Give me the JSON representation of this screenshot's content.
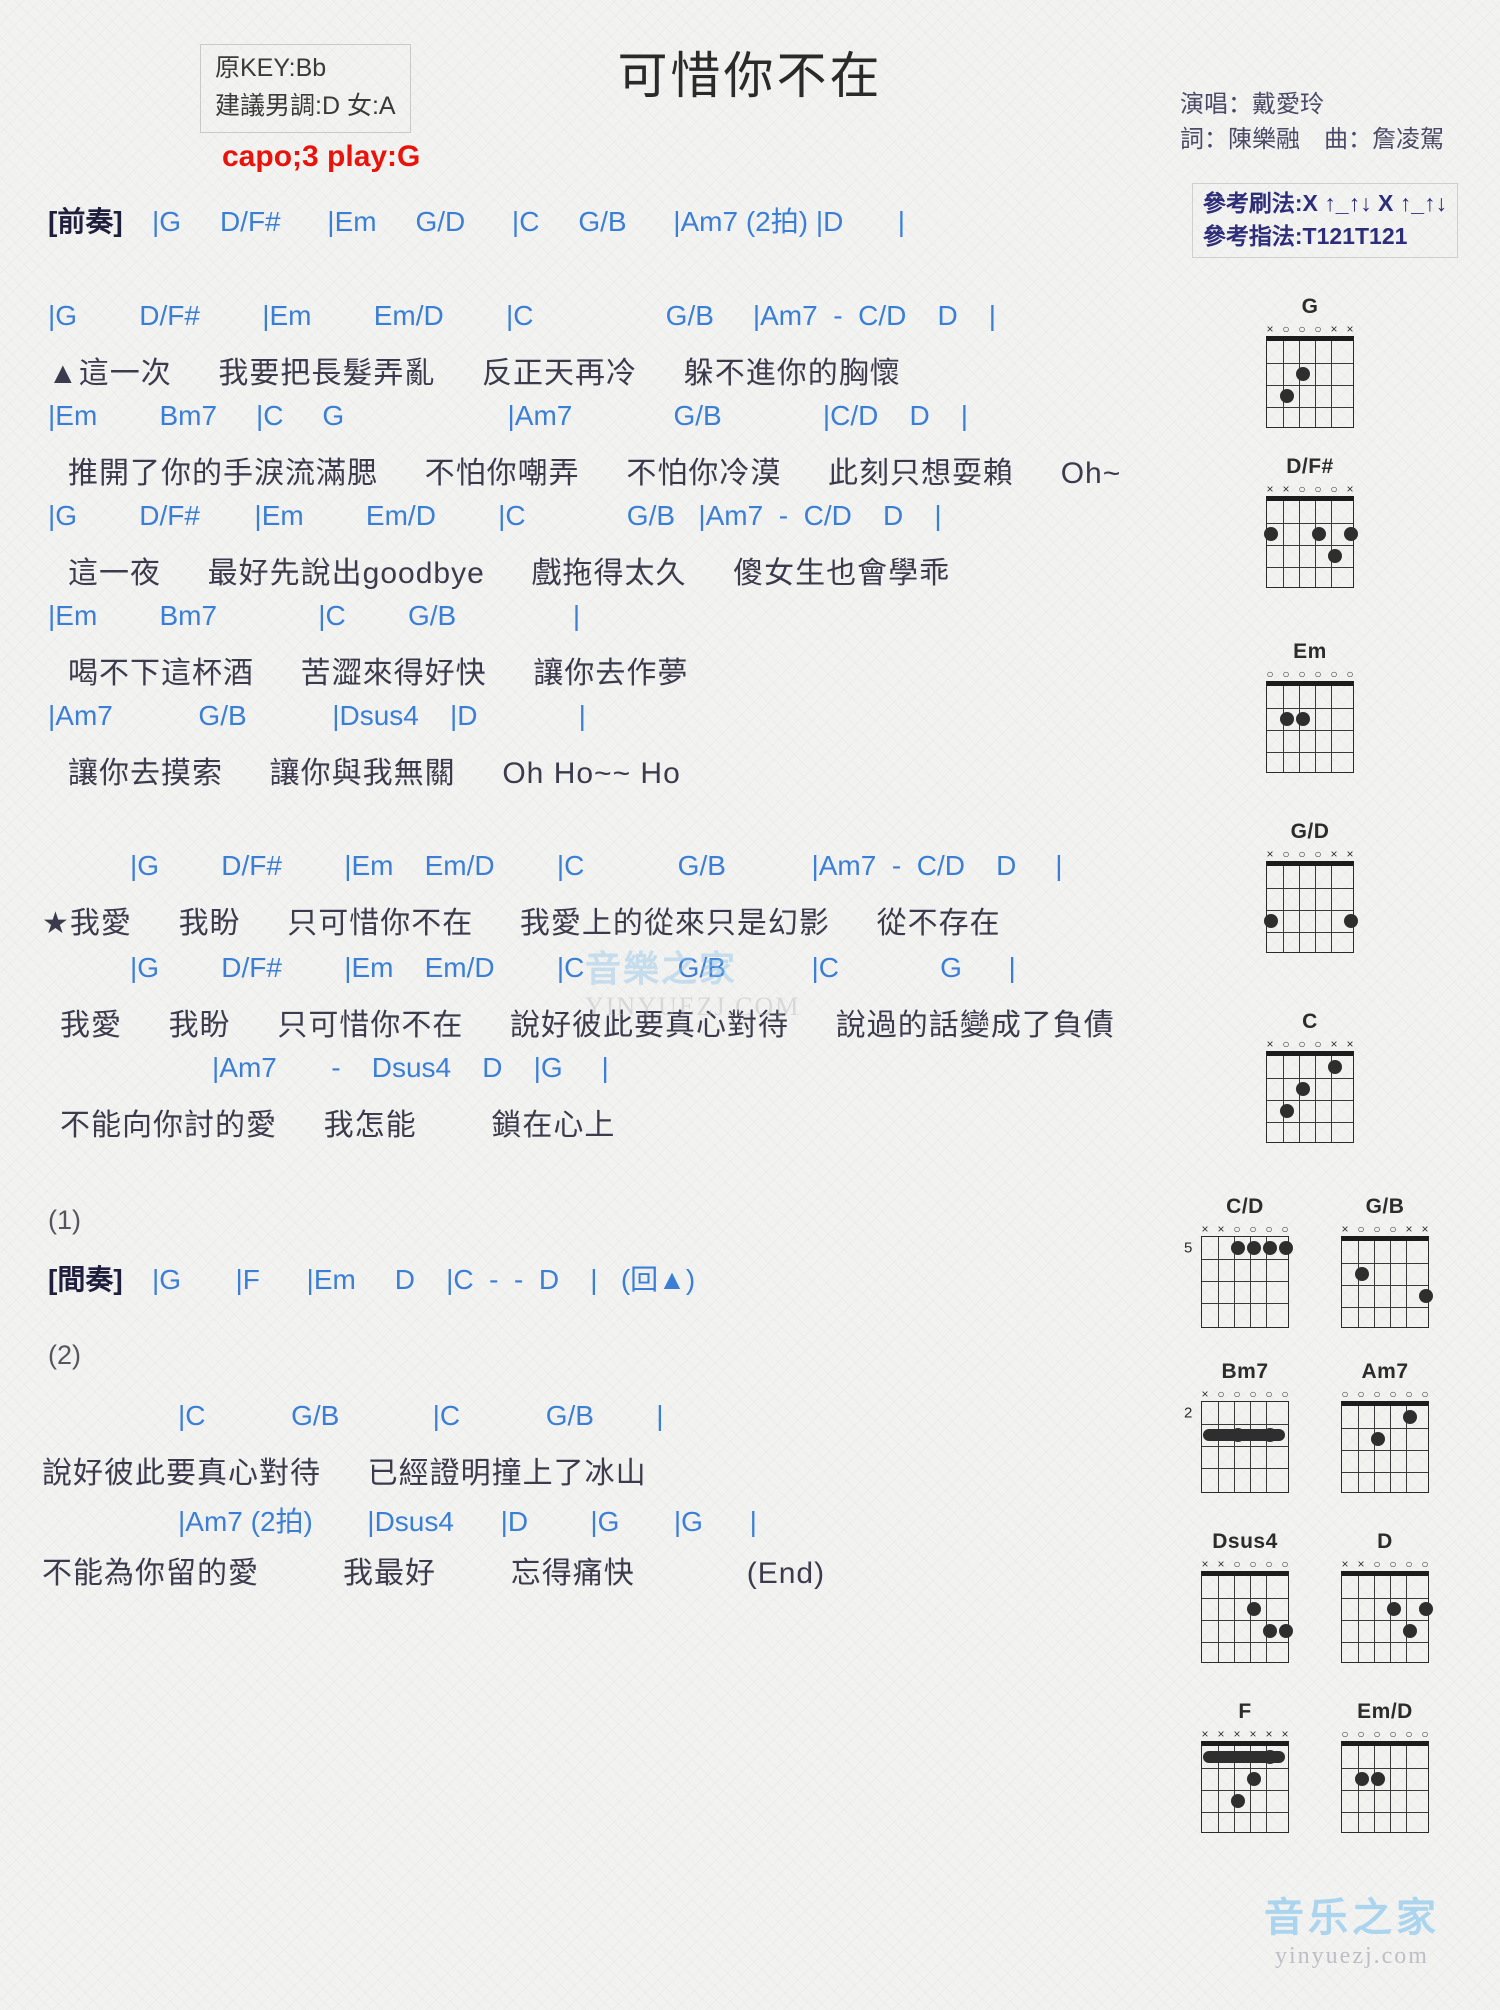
{
  "header": {
    "title": "可惜你不在",
    "key_box": {
      "original_key": "原KEY:Bb",
      "suggested_key": "建議男調:D 女:A"
    },
    "capo": "capo;3 play:G",
    "credits": {
      "singer": "演唱：戴愛玲",
      "writers": "詞：陳樂融　曲：詹凌駕"
    },
    "patterns": {
      "strum": "參考刷法:X ↑_↑↓ X ↑_↑↓",
      "fingerstyle": "參考指法:T121T121"
    }
  },
  "sections": {
    "intro": {
      "tag": "[前奏]",
      "chords": "|G     D/F#      |Em     G/D      |C     G/B      |Am7 (2拍) |D       |"
    },
    "verse1": {
      "line1_chords": "|G        D/F#        |Em        Em/D        |C                 G/B     |Am7  -  C/D    D    |",
      "line1_lyrics": "▲這一次     我要把長髮弄亂     反正天再冷     躲不進你的胸懷",
      "line2_chords": "|Em        Bm7     |C     G                     |Am7             G/B             |C/D    D    |",
      "line2_lyrics": "推開了你的手淚流滿腮     不怕你嘲弄     不怕你冷漠     此刻只想耍賴     Oh~",
      "line3_chords": "|G        D/F#       |Em        Em/D        |C             G/B   |Am7  -  C/D    D    |",
      "line3_lyrics": "這一夜     最好先說出goodbye     戲拖得太久     傻女生也會學乖",
      "line4_chords": "|Em        Bm7             |C        G/B               |",
      "line4_lyrics": "喝不下這杯酒     苦澀來得好快     讓你去作夢",
      "line5_chords": "|Am7           G/B           |Dsus4    |D             |",
      "line5_lyrics": "讓你去摸索     讓你與我無關     Oh Ho~~ Ho"
    },
    "chorus": {
      "line1_chords": "|G        D/F#        |Em    Em/D        |C            G/B           |Am7  -  C/D    D     |",
      "line1_lyrics": "★我愛     我盼     只可惜你不在     我愛上的從來只是幻影     從不存在",
      "line2_chords": "|G        D/F#        |Em    Em/D        |C            G/B           |C             G      |",
      "line2_lyrics": "我愛     我盼     只可惜你不在     說好彼此要真心對待     說過的話變成了負債",
      "line3_chords": "|Am7       -    Dsus4    D    |G     |",
      "line3_lyrics": "不能向你討的愛     我怎能        鎖在心上"
    },
    "ending1": {
      "number": "(1)",
      "tag": "[間奏]",
      "chords": "|G       |F      |Em     D    |C  -  -  D    |   (回▲)"
    },
    "ending2": {
      "number": "(2)",
      "line1_chords": "|C           G/B            |C           G/B        |",
      "line1_lyrics": "說好彼此要真心對待     已經證明撞上了冰山",
      "line2_chords": "|Am7 (2拍)       |Dsus4      |D        |G       |G      |",
      "line2_lyrics": "不能為你留的愛         我最好        忘得痛快            (End)"
    }
  },
  "chord_diagrams": [
    {
      "name": "G",
      "start_fret": "",
      "markers": [
        "x",
        "o",
        "o",
        "o",
        "x",
        "x"
      ],
      "dots": [
        [
          5,
          3
        ],
        [
          4,
          2
        ]
      ],
      "barre": null
    },
    {
      "name": "D/F#",
      "start_fret": "",
      "markers": [
        "x",
        "x",
        "o",
        "o",
        "o",
        "x"
      ],
      "dots": [
        [
          6,
          2
        ],
        [
          3,
          2
        ],
        [
          2,
          3
        ],
        [
          1,
          2
        ]
      ],
      "barre": null
    },
    {
      "name": "Em",
      "start_fret": "",
      "markers": [
        "o",
        "o",
        "o",
        "o",
        "o",
        "o"
      ],
      "dots": [
        [
          5,
          2
        ],
        [
          4,
          2
        ]
      ],
      "barre": null
    },
    {
      "name": "G/D",
      "start_fret": "",
      "markers": [
        "x",
        "o",
        "o",
        "o",
        "x",
        "x"
      ],
      "dots": [
        [
          6,
          3
        ],
        [
          1,
          3
        ]
      ],
      "barre": null
    },
    {
      "name": "C",
      "start_fret": "",
      "markers": [
        "x",
        "o",
        "o",
        "o",
        "x",
        "x"
      ],
      "dots": [
        [
          5,
          3
        ],
        [
          4,
          2
        ],
        [
          2,
          1
        ]
      ],
      "barre": null
    },
    {
      "name": "C/D",
      "start_fret": "5",
      "markers": [
        "x",
        "x",
        "o",
        "o",
        "o",
        "o"
      ],
      "dots": [
        [
          4,
          1
        ],
        [
          3,
          1
        ],
        [
          2,
          1
        ],
        [
          1,
          1
        ]
      ],
      "barre": null
    },
    {
      "name": "G/B",
      "start_fret": "",
      "markers": [
        "x",
        "o",
        "o",
        "o",
        "x",
        "x"
      ],
      "dots": [
        [
          5,
          2
        ],
        [
          1,
          3
        ]
      ],
      "barre": null
    },
    {
      "name": "Bm7",
      "start_fret": "2",
      "markers": [
        "x",
        "o",
        "o",
        "o",
        "o",
        "o"
      ],
      "dots": [
        [
          4,
          2
        ],
        [
          2,
          2
        ]
      ],
      "barre": "2"
    },
    {
      "name": "Am7",
      "start_fret": "",
      "markers": [
        "o",
        "o",
        "o",
        "o",
        "o",
        "o"
      ],
      "dots": [
        [
          4,
          2
        ],
        [
          2,
          1
        ]
      ],
      "barre": null
    },
    {
      "name": "Dsus4",
      "start_fret": "",
      "markers": [
        "x",
        "x",
        "o",
        "o",
        "o",
        "o"
      ],
      "dots": [
        [
          3,
          2
        ],
        [
          2,
          3
        ],
        [
          1,
          3
        ]
      ],
      "barre": null
    },
    {
      "name": "D",
      "start_fret": "",
      "markers": [
        "x",
        "x",
        "o",
        "o",
        "o",
        "o"
      ],
      "dots": [
        [
          3,
          2
        ],
        [
          2,
          3
        ],
        [
          1,
          2
        ]
      ],
      "barre": null
    },
    {
      "name": "F",
      "start_fret": "",
      "markers": [
        "x",
        "x",
        "x",
        "x",
        "x",
        "x"
      ],
      "dots": [
        [
          4,
          3
        ],
        [
          3,
          2
        ],
        [
          2,
          1
        ]
      ],
      "barre": "1"
    },
    {
      "name": "Em/D",
      "start_fret": "",
      "markers": [
        "o",
        "o",
        "o",
        "o",
        "o",
        "o"
      ],
      "dots": [
        [
          5,
          2
        ],
        [
          4,
          2
        ]
      ],
      "barre": null
    }
  ],
  "watermark": {
    "center_main": "音樂之家",
    "center_sub": "YINYUEZJ.COM",
    "bottom_main": "音乐之家",
    "bottom_sub": "yinyuezj.com"
  },
  "colors": {
    "chord": "#3a7fd5",
    "lyric": "#3b3b4d",
    "accent_red": "#e8140c",
    "bar": "#23306e"
  }
}
